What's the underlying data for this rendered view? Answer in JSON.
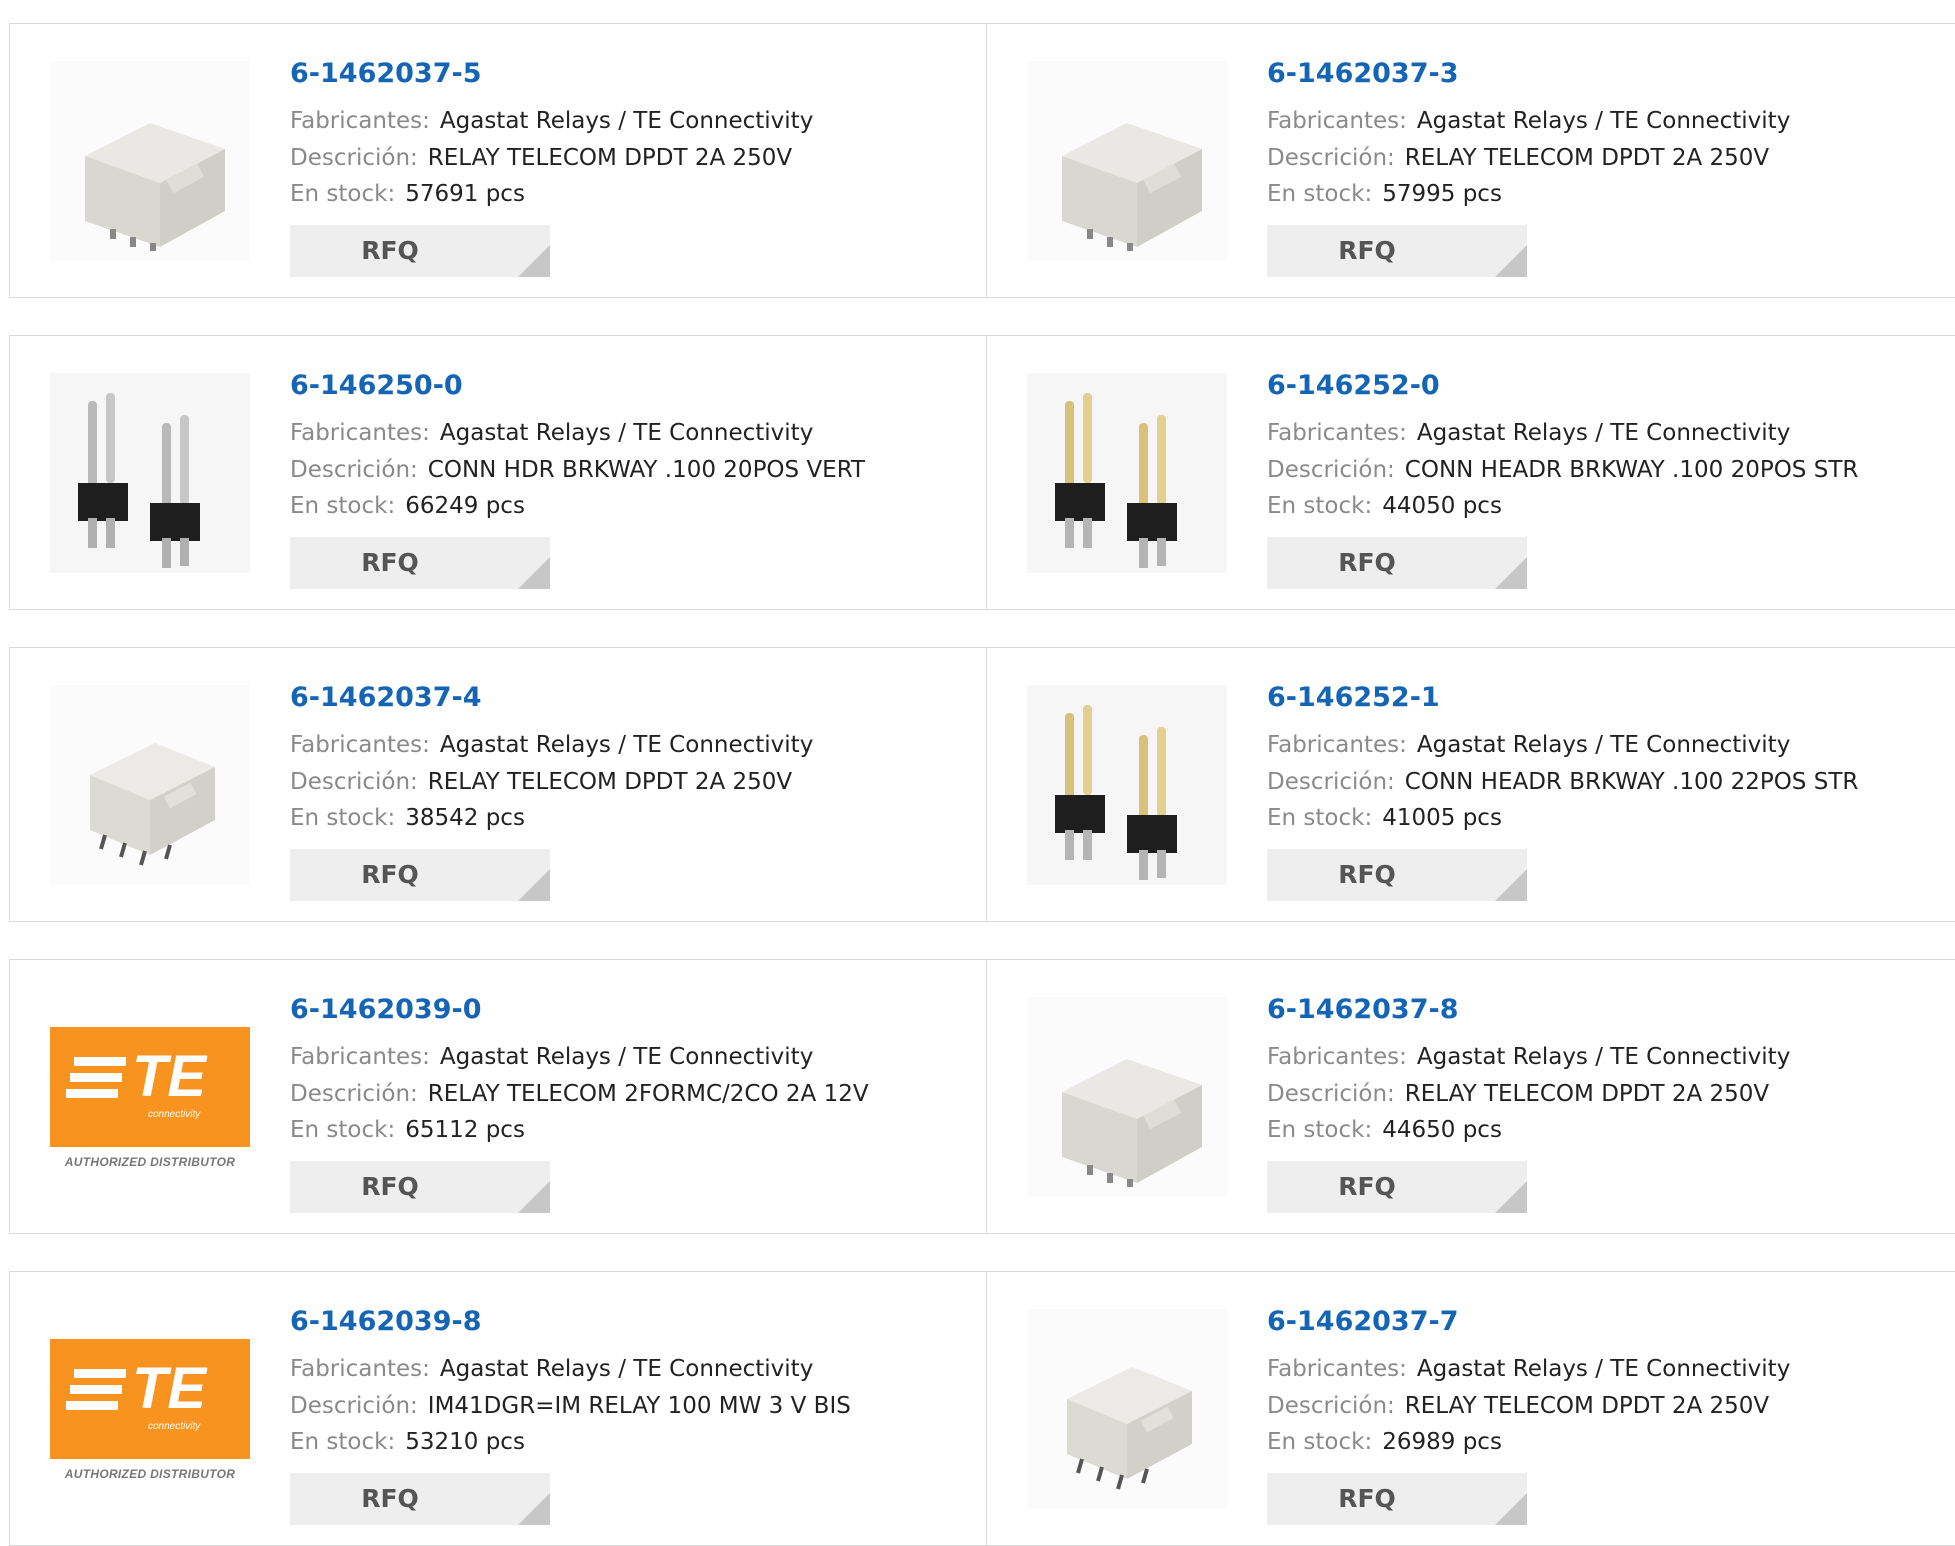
{
  "labels": {
    "manufacturer": "Fabricantes:",
    "description": "Descrición:",
    "stock": "En stock:",
    "rfq": "RFQ",
    "te_logo_text": "TE",
    "te_logo_sub": "connectivity",
    "te_authorized": "AUTHORIZED DISTRIBUTOR"
  },
  "products": [
    {
      "pn": "6-1462037-5",
      "mfr": "Agastat Relays / TE Connectivity",
      "desc": "RELAY TELECOM DPDT 2A 250V",
      "stock": "57691 pcs",
      "img": "relay-block"
    },
    {
      "pn": "6-1462037-3",
      "mfr": "Agastat Relays / TE Connectivity",
      "desc": "RELAY TELECOM DPDT 2A 250V",
      "stock": "57995 pcs",
      "img": "relay-block"
    },
    {
      "pn": "6-146250-0",
      "mfr": "Agastat Relays / TE Connectivity",
      "desc": "CONN HDR BRKWAY .100 20POS VERT",
      "stock": "66249 pcs",
      "img": "header-silver"
    },
    {
      "pn": "6-146252-0",
      "mfr": "Agastat Relays / TE Connectivity",
      "desc": "CONN HEADR BRKWAY .100 20POS STR",
      "stock": "44050 pcs",
      "img": "header-gold"
    },
    {
      "pn": "6-1462037-4",
      "mfr": "Agastat Relays / TE Connectivity",
      "desc": "RELAY TELECOM DPDT 2A 250V",
      "stock": "38542 pcs",
      "img": "relay-smd"
    },
    {
      "pn": "6-146252-1",
      "mfr": "Agastat Relays / TE Connectivity",
      "desc": "CONN HEADR BRKWAY .100 22POS STR",
      "stock": "41005 pcs",
      "img": "header-gold"
    },
    {
      "pn": "6-1462039-0",
      "mfr": "Agastat Relays / TE Connectivity",
      "desc": "RELAY TELECOM 2FORMC/2CO 2A 12V",
      "stock": "65112 pcs",
      "img": "te-logo"
    },
    {
      "pn": "6-1462037-8",
      "mfr": "Agastat Relays / TE Connectivity",
      "desc": "RELAY TELECOM DPDT 2A 250V",
      "stock": "44650 pcs",
      "img": "relay-block"
    },
    {
      "pn": "6-1462039-8",
      "mfr": "Agastat Relays / TE Connectivity",
      "desc": "IM41DGR=IM RELAY 100 MW 3 V BIS",
      "stock": "53210 pcs",
      "img": "te-logo"
    },
    {
      "pn": "6-1462037-7",
      "mfr": "Agastat Relays / TE Connectivity",
      "desc": "RELAY TELECOM DPDT 2A 250V",
      "stock": "26989 pcs",
      "img": "relay-smd"
    }
  ],
  "colors": {
    "link": "#1565b7",
    "te_orange": "#f7931e",
    "rfq_bg": "#eeeeee"
  }
}
